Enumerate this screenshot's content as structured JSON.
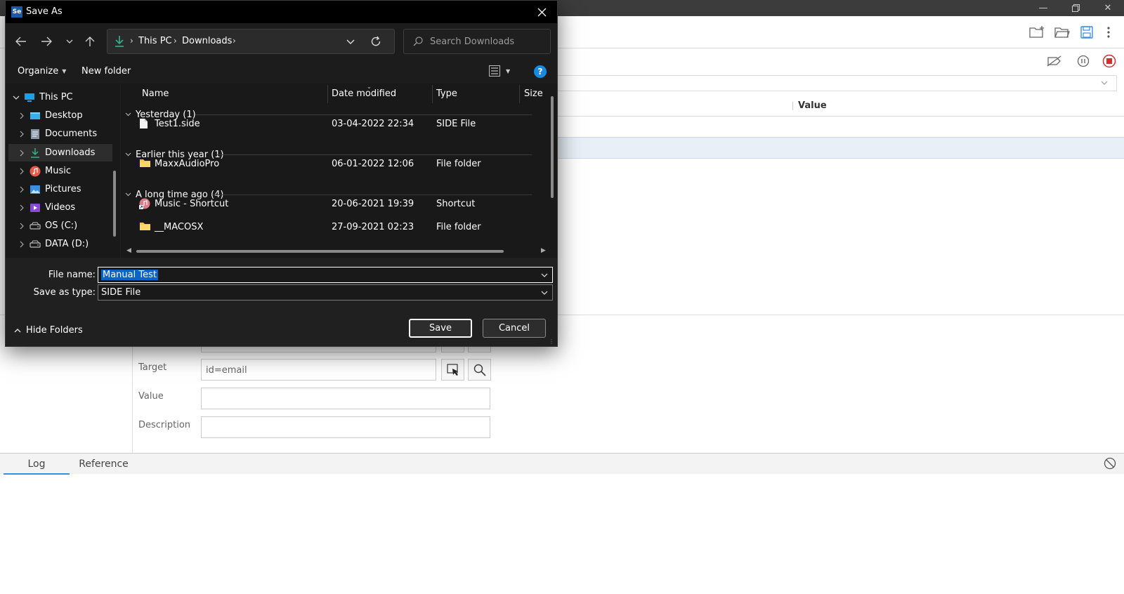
{
  "background_app": {
    "table": {
      "value_header": "Value"
    },
    "editor": {
      "target_label": "Target",
      "target_value": "id=email",
      "value_label": "Value",
      "description_label": "Description"
    },
    "console": {
      "tabs": [
        "Log",
        "Reference"
      ]
    }
  },
  "dialog": {
    "title": "Save As",
    "app_icon_text": "Se",
    "breadcrumb": [
      "This PC",
      "Downloads"
    ],
    "search_placeholder": "Search Downloads",
    "organize_label": "Organize",
    "new_folder_label": "New folder",
    "help_label": "?",
    "tree": [
      {
        "label": "This PC",
        "icon": "pc-icon",
        "expanded": true
      },
      {
        "label": "Desktop",
        "icon": "desktop-icon"
      },
      {
        "label": "Documents",
        "icon": "documents-icon"
      },
      {
        "label": "Downloads",
        "icon": "download-icon",
        "selected": true
      },
      {
        "label": "Music",
        "icon": "music-icon"
      },
      {
        "label": "Pictures",
        "icon": "pictures-icon"
      },
      {
        "label": "Videos",
        "icon": "videos-icon"
      },
      {
        "label": "OS (C:)",
        "icon": "drive-icon"
      },
      {
        "label": "DATA (D:)",
        "icon": "drive-icon"
      }
    ],
    "columns": [
      "Name",
      "Date modified",
      "Type",
      "Size"
    ],
    "groups": [
      {
        "header": "Yesterday (1)",
        "files": [
          {
            "name": "Test1.side",
            "date": "03-04-2022 22:34",
            "type": "SIDE File",
            "icon": "file-icon"
          }
        ]
      },
      {
        "header": "Earlier this year (1)",
        "files": [
          {
            "name": "MaxxAudioPro",
            "date": "06-01-2022 12:06",
            "type": "File folder",
            "icon": "folder-icon"
          }
        ]
      },
      {
        "header": "A long time ago (4)",
        "files": [
          {
            "name": "Music - Shortcut",
            "date": "20-06-2021 19:39",
            "type": "Shortcut",
            "icon": "music-shortcut-icon"
          },
          {
            "name": "__MACOSX",
            "date": "27-09-2021 02:23",
            "type": "File folder",
            "icon": "folder-icon"
          }
        ]
      }
    ],
    "file_name_label": "File name:",
    "file_name_value": "Manual Test",
    "save_type_label": "Save as type:",
    "save_type_value": "SIDE File",
    "hide_folders_label": "Hide Folders",
    "save_label": "Save",
    "cancel_label": "Cancel",
    "colors": {
      "accent": "#0078d4",
      "selection": "#0a64c8",
      "folder": "#f8c84a"
    }
  }
}
